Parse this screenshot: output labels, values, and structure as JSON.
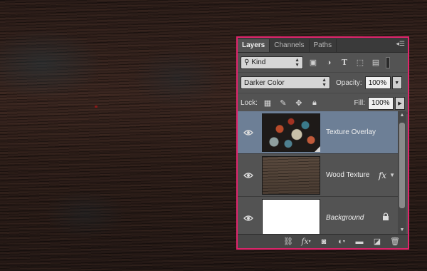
{
  "panel": {
    "tabs": [
      {
        "label": "Layers",
        "active": true
      },
      {
        "label": "Channels",
        "active": false
      },
      {
        "label": "Paths",
        "active": false
      }
    ],
    "menu_icon": "panel-menu-icon"
  },
  "filter": {
    "kind_label": "Kind",
    "icons": [
      "pixel-filter-icon",
      "adjustment-filter-icon",
      "type-filter-icon",
      "shape-filter-icon",
      "smart-object-filter-icon"
    ]
  },
  "blend": {
    "mode": "Darker Color",
    "opacity_label": "Opacity:",
    "opacity_value": "100%"
  },
  "lock": {
    "label": "Lock:",
    "icons": [
      "lock-transparent-icon",
      "lock-image-icon",
      "lock-position-icon",
      "lock-all-icon"
    ],
    "fill_label": "Fill:",
    "fill_value": "100%"
  },
  "layers": [
    {
      "name": "Texture Overlay",
      "selected": true,
      "thumb": "texture",
      "fx": false,
      "locked": false,
      "italic": false
    },
    {
      "name": "Wood Texture",
      "selected": false,
      "thumb": "wood",
      "fx": true,
      "fx_label": "fx",
      "locked": false,
      "italic": false
    },
    {
      "name": "Background",
      "selected": false,
      "thumb": "white",
      "fx": false,
      "locked": true,
      "italic": true
    }
  ],
  "footer": {
    "icons": [
      "link-layers-icon",
      "fx-icon",
      "add-mask-icon",
      "adjustment-layer-icon",
      "new-group-icon",
      "new-layer-icon",
      "delete-layer-icon"
    ],
    "fx_label": "fx"
  },
  "colors": {
    "accent_border": "#e0246c",
    "selected_layer": "#6d7f96",
    "panel_bg": "#535353"
  }
}
